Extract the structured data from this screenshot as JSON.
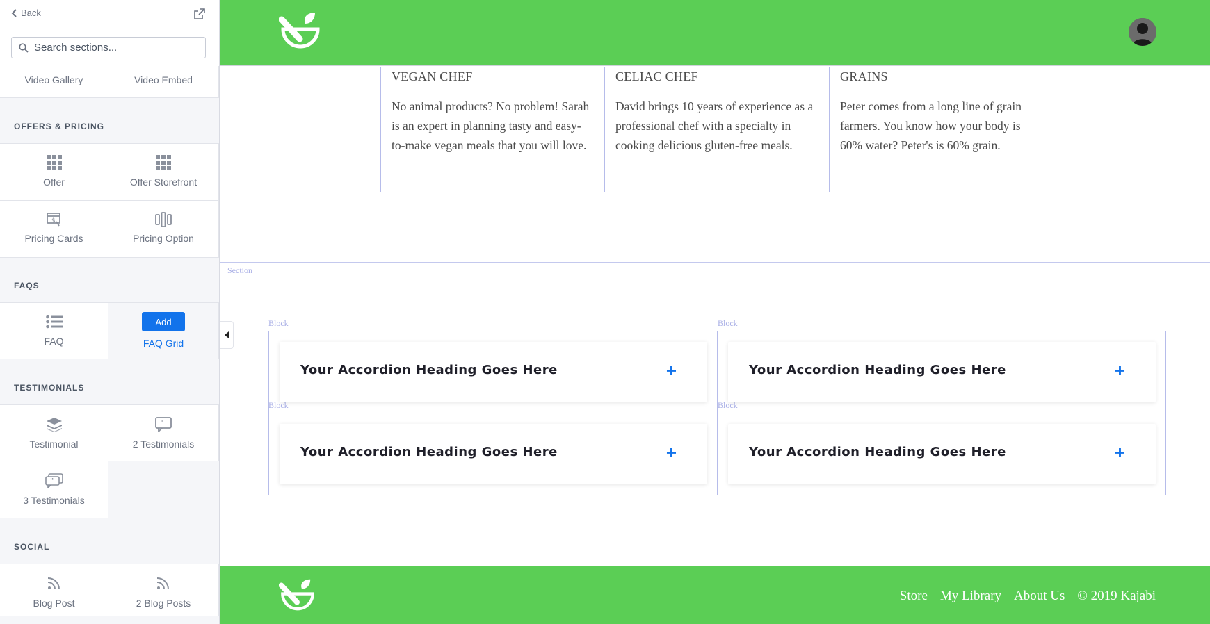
{
  "sidebar": {
    "back_label": "Back",
    "search_placeholder": "Search sections...",
    "sections": {
      "media_tiles": [
        "Video Gallery",
        "Video Embed"
      ],
      "offers_heading": "OFFERS & PRICING",
      "offers_tiles": [
        "Offer",
        "Offer Storefront",
        "Pricing Cards",
        "Pricing Option"
      ],
      "faqs_heading": "FAQS",
      "faqs_tiles": [
        "FAQ",
        "FAQ Grid"
      ],
      "add_label": "Add",
      "testimonials_heading": "TESTIMONIALS",
      "testimonials_tiles": [
        "Testimonial",
        "2 Testimonials",
        "3 Testimonials"
      ],
      "social_heading": "SOCIAL",
      "social_tiles": [
        "Blog Post",
        "2 Blog Posts"
      ]
    }
  },
  "page": {
    "columns": [
      {
        "title": "VEGAN CHEF",
        "text": "No animal products? No problem! Sarah is an expert in planning tasty and easy-to-make vegan meals that you will love."
      },
      {
        "title": "CELIAC CHEF",
        "text": "David brings 10 years of experience as a professional chef with a specialty in cooking delicious gluten-free meals."
      },
      {
        "title": "GRAINS",
        "text": "Peter comes from a long line of grain farmers. You know how your body is 60% water? Peter's is 60% grain."
      }
    ],
    "section_tag": "Section",
    "block_tag": "Block",
    "accordions": [
      "Your Accordion Heading Goes Here",
      "Your Accordion Heading Goes Here",
      "Your Accordion Heading Goes Here",
      "Your Accordion Heading Goes Here"
    ],
    "plus": "+"
  },
  "footer": {
    "links": [
      "Store",
      "My Library",
      "About Us",
      "© 2019 Kajabi"
    ]
  },
  "colors": {
    "brand_green": "#5bce55",
    "accent_blue": "#1273eb"
  }
}
